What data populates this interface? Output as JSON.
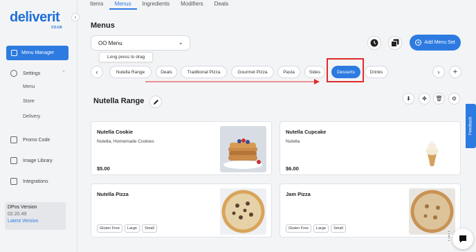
{
  "brand": {
    "name": "deliverit",
    "sub": "CO.UK",
    "accent": "#2d7be0",
    "highlight": "#e02b2b"
  },
  "sidebar": {
    "collapse_icon": "chevron-left-icon",
    "active_item": "Menu Manager",
    "settings_label": "Settings",
    "settings_subitems": [
      "Menu",
      "Store",
      "Delivery"
    ],
    "items": [
      "Promo Code",
      "Image Library",
      "Integrations"
    ],
    "version_label": "DPos Version",
    "version": "02.20.49",
    "latest_link": "Latest Version"
  },
  "topnav": {
    "tabs": [
      "Items",
      "Menus",
      "Ingredients",
      "Modifiers",
      "Deals"
    ],
    "active": "Menus"
  },
  "page": {
    "title": "Menus",
    "menu_select": "OO Menu",
    "add_menu_label": "Add Menu Set",
    "tooltip": "Long press to drag"
  },
  "categories": {
    "chips": [
      "Nutella Range",
      "Deals",
      "Traditional Pizza",
      "Gourmet Pizza",
      "Pasta",
      "Sides",
      "Desserts",
      "Drinks"
    ],
    "active": "Desserts"
  },
  "section": {
    "title": "Nutella Range"
  },
  "cards": [
    {
      "name": "Nutella Cookie",
      "desc": "Nutella, Homemade Cookies",
      "price": "$5.00",
      "tags": []
    },
    {
      "name": "Nutella Cupcake",
      "desc": "Nutella",
      "price": "$6.00",
      "tags": []
    },
    {
      "name": "Nutella Pizza",
      "desc": "",
      "price": "",
      "tags": [
        "Gluten Free",
        "Large",
        "Small"
      ]
    },
    {
      "name": "Jam Pizza",
      "desc": "",
      "price": "",
      "tags": [
        "Gluten Free",
        "Large",
        "Small"
      ]
    }
  ],
  "feedback_label": "Feedback"
}
